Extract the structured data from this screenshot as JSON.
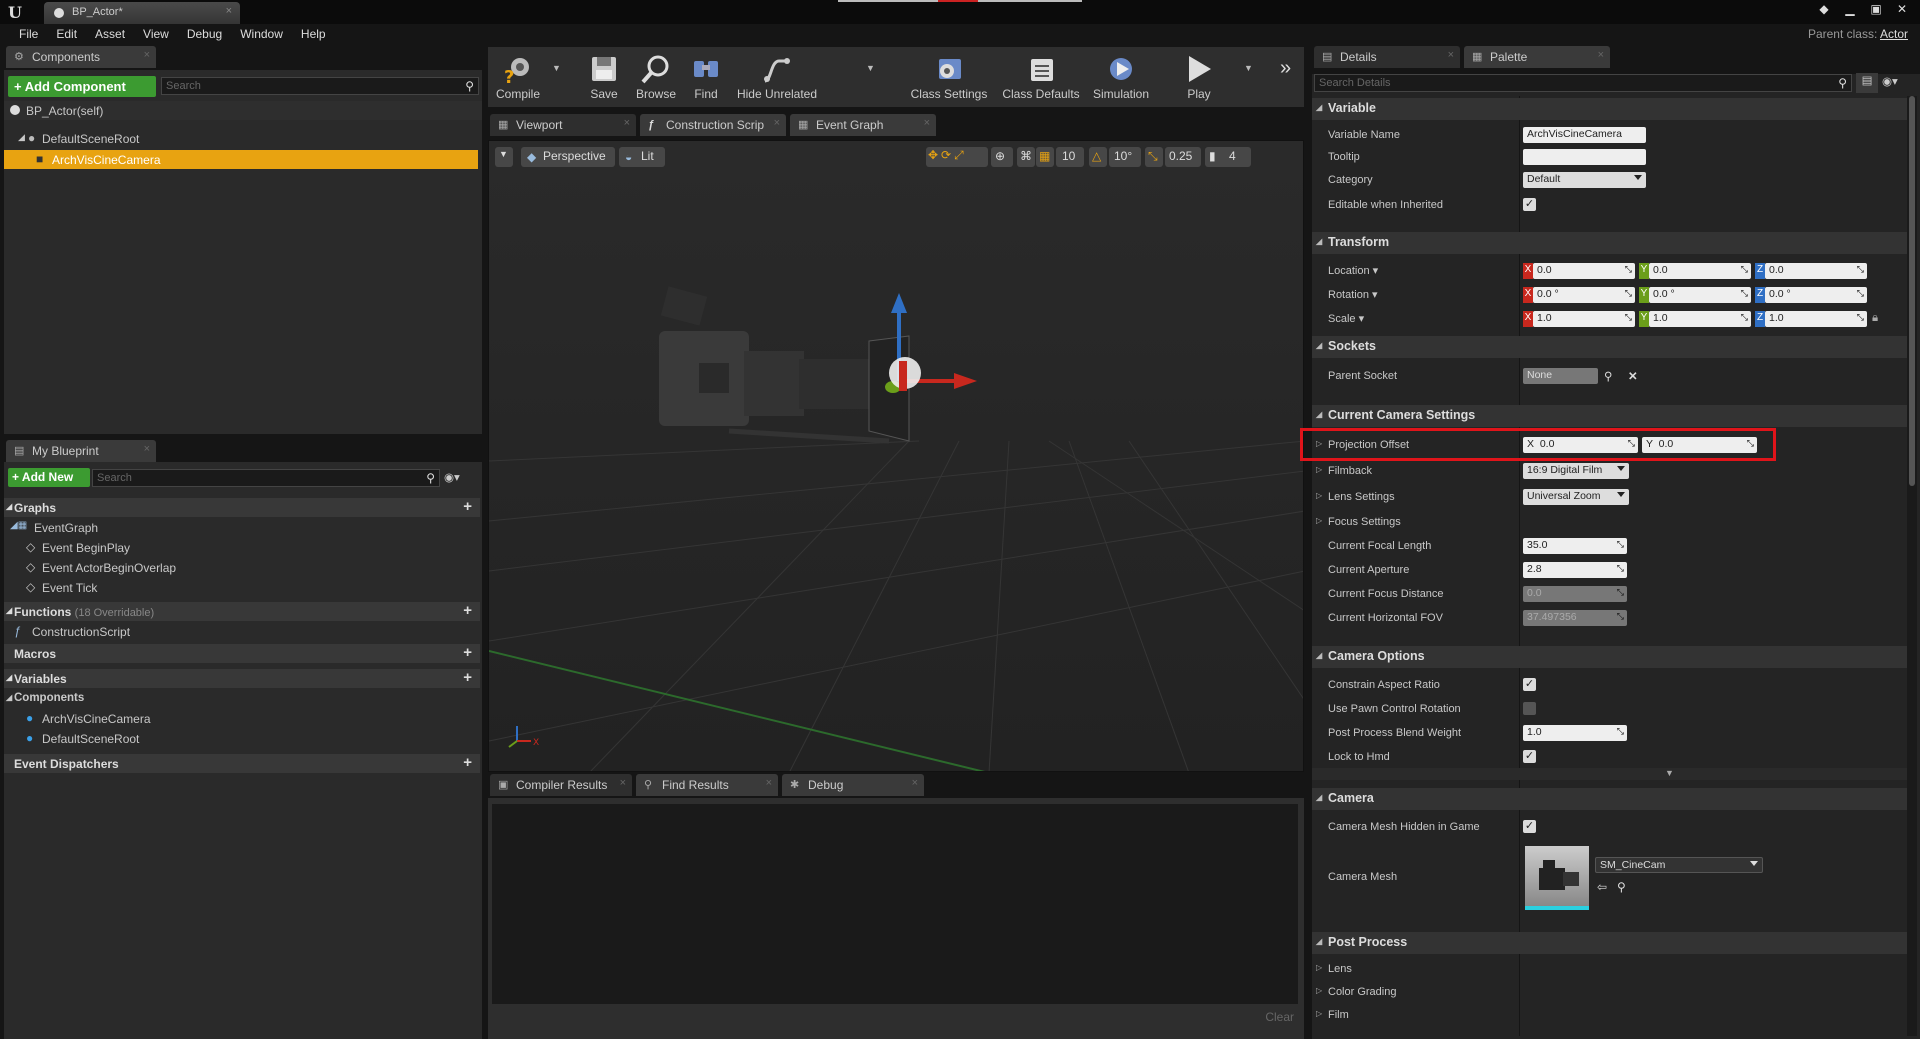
{
  "window": {
    "tab_title": "BP_Actor*",
    "parent_class_label": "Parent class:",
    "parent_class": "Actor"
  },
  "menu": [
    "File",
    "Edit",
    "Asset",
    "View",
    "Debug",
    "Window",
    "Help"
  ],
  "components": {
    "tab": "Components",
    "add_button": "+ Add Component",
    "search_placeholder": "Search",
    "self": "BP_Actor(self)",
    "tree": [
      "DefaultSceneRoot",
      "ArchVisCineCamera"
    ]
  },
  "my_blueprint": {
    "tab": "My Blueprint",
    "add_button": "+ Add New",
    "search_placeholder": "Search",
    "graphs_label": "Graphs",
    "event_graph": "EventGraph",
    "events": [
      "Event BeginPlay",
      "Event ActorBeginOverlap",
      "Event Tick"
    ],
    "functions_label": "Functions",
    "functions_count": "(18 Overridable)",
    "construction_script": "ConstructionScript",
    "macros_label": "Macros",
    "variables_label": "Variables",
    "components_label": "Components",
    "component_vars": [
      "ArchVisCineCamera",
      "DefaultSceneRoot"
    ],
    "dispatchers_label": "Event Dispatchers"
  },
  "toolbar": {
    "items": [
      "Compile",
      "Save",
      "Browse",
      "Find",
      "Hide Unrelated",
      "Class Settings",
      "Class Defaults",
      "Simulation",
      "Play"
    ]
  },
  "editor_tabs": [
    "Viewport",
    "Construction Scrip",
    "Event Graph"
  ],
  "viewport": {
    "perspective": "Perspective",
    "lit": "Lit",
    "grid_snap": "10",
    "rot_snap": "10°",
    "scale_snap": "0.25",
    "cam_speed": "4"
  },
  "bottom_tabs": [
    "Compiler Results",
    "Find Results",
    "Debug"
  ],
  "bottom_clear": "Clear",
  "details": {
    "tabs": [
      "Details",
      "Palette"
    ],
    "search_placeholder": "Search Details",
    "variable": {
      "title": "Variable",
      "name_label": "Variable Name",
      "name_value": "ArchVisCineCamera",
      "tooltip_label": "Tooltip",
      "tooltip_value": "",
      "category_label": "Category",
      "category_value": "Default",
      "editable_label": "Editable when Inherited"
    },
    "transform": {
      "title": "Transform",
      "rows": [
        {
          "label": "Location",
          "x": "0.0",
          "y": "0.0",
          "z": "0.0"
        },
        {
          "label": "Rotation",
          "x": "0.0 °",
          "y": "0.0 °",
          "z": "0.0 °"
        },
        {
          "label": "Scale",
          "x": "1.0",
          "y": "1.0",
          "z": "1.0"
        }
      ]
    },
    "sockets": {
      "title": "Sockets",
      "parent_label": "Parent Socket",
      "parent_value": "None"
    },
    "current_camera": {
      "title": "Current Camera Settings",
      "projection_label": "Projection Offset",
      "proj_x": "0.0",
      "proj_y": "0.0",
      "filmback_label": "Filmback",
      "filmback_value": "16:9 Digital Film",
      "lens_label": "Lens Settings",
      "lens_value": "Universal Zoom",
      "focus_label": "Focus Settings",
      "focal_label": "Current Focal Length",
      "focal_value": "35.0",
      "aperture_label": "Current Aperture",
      "aperture_value": "2.8",
      "focus_dist_label": "Current Focus Distance",
      "focus_dist_value": "0.0",
      "fov_label": "Current Horizontal FOV",
      "fov_value": "37.497356"
    },
    "camera_options": {
      "title": "Camera Options",
      "constrain_label": "Constrain Aspect Ratio",
      "pawn_label": "Use Pawn Control Rotation",
      "blend_label": "Post Process Blend Weight",
      "blend_value": "1.0",
      "hmd_label": "Lock to Hmd"
    },
    "camera": {
      "title": "Camera",
      "hidden_label": "Camera Mesh Hidden in Game",
      "mesh_label": "Camera Mesh",
      "mesh_value": "SM_CineCam"
    },
    "post_process": {
      "title": "Post Process",
      "items": [
        "Lens",
        "Color Grading",
        "Film"
      ]
    }
  },
  "colors": {
    "accent_orange": "#e8a311",
    "highlight_red": "#e0141a",
    "green_button": "#3c9b31",
    "axis_x": "#c8281e",
    "axis_y": "#6b9e1a",
    "axis_z": "#2f6fc4"
  }
}
